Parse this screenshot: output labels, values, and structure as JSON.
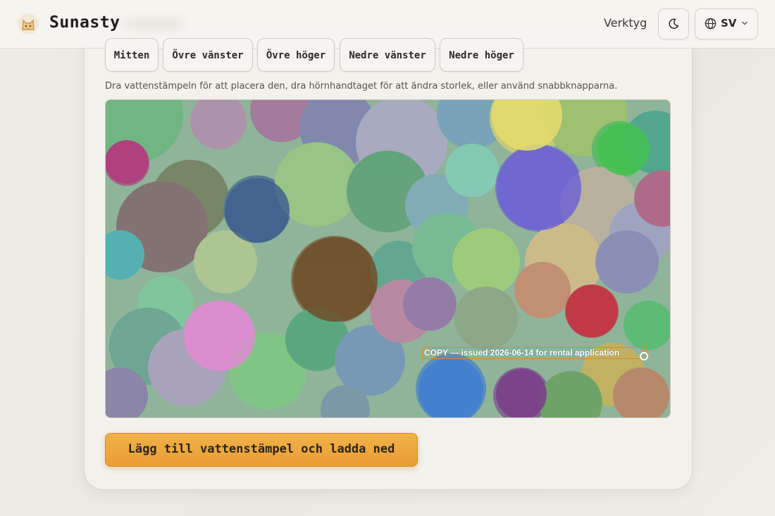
{
  "header": {
    "brand": "Sunasty",
    "nav_tools": "Verktyg",
    "theme_icon": "moon-icon",
    "language": {
      "code": "SV",
      "icon": "globe-icon",
      "caret_icon": "chevron-down-icon"
    }
  },
  "position_buttons": [
    {
      "label": "Mitten"
    },
    {
      "label": "Övre vänster"
    },
    {
      "label": "Övre höger"
    },
    {
      "label": "Nedre vänster"
    },
    {
      "label": "Nedre höger"
    }
  ],
  "instructions": "Dra vattenstämpeln för att placera den, dra hörnhandtaget för att ändra storlek, eller använd snabbknapparna.",
  "watermark": {
    "text": "COPY — issued 2026-06-14 for rental application",
    "border_color": "#e08a1e"
  },
  "submit_button": "Lägg till vattenstämpel och ladda ned",
  "colors": {
    "accent": "#f0a93f",
    "card": "#f3f1ec",
    "background": "#ece9e3"
  }
}
